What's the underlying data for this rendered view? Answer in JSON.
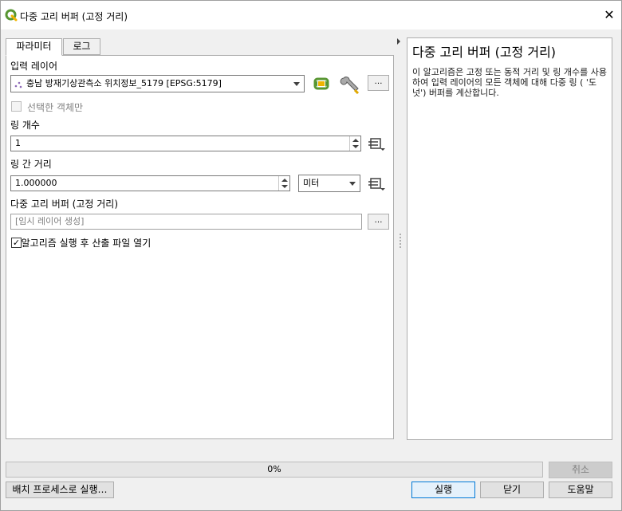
{
  "window": {
    "title": "다중 고리 버퍼 (고정 거리)",
    "close_glyph": "✕"
  },
  "tabs": [
    {
      "label": "파라미터",
      "active": true
    },
    {
      "label": "로그",
      "active": false
    }
  ],
  "params": {
    "input_layer": {
      "label": "입력 레이어",
      "value": "충남 방재기상관측소 위치정보_5179 [EPSG:5179]",
      "icon": "point-layer-icon"
    },
    "selected_only": {
      "label": "선택한 객체만",
      "checked": false,
      "enabled": false
    },
    "ring_count": {
      "label": "링 개수",
      "value": "1"
    },
    "ring_distance": {
      "label": "링 간 거리",
      "value": "1.000000",
      "unit": "미터"
    },
    "output": {
      "label": "다중 고리 버퍼 (고정 거리)",
      "placeholder": "[임시 레이어 생성]"
    },
    "open_after": {
      "label": "알고리즘 실행 후 산출 파일 열기",
      "checked": true
    }
  },
  "dots_label": "…",
  "help": {
    "title": "다중 고리 버퍼 (고정 거리)",
    "body": "이 알고리즘은 고정 또는 동적 거리 및 링 개수를 사용하여 입력 레이어의 모든 객체에 대해 다중 링 ( '도넛') 버퍼를 계산합니다."
  },
  "progress": {
    "value": 0,
    "text": "0%"
  },
  "buttons": {
    "cancel": "취소",
    "batch": "배치 프로세스로 실행…",
    "run": "실행",
    "close": "닫기",
    "help": "도움말"
  },
  "colors": {
    "qgis_green": "#589632",
    "qgis_yellow": "#f0b400",
    "focus_blue": "#0078d7"
  }
}
